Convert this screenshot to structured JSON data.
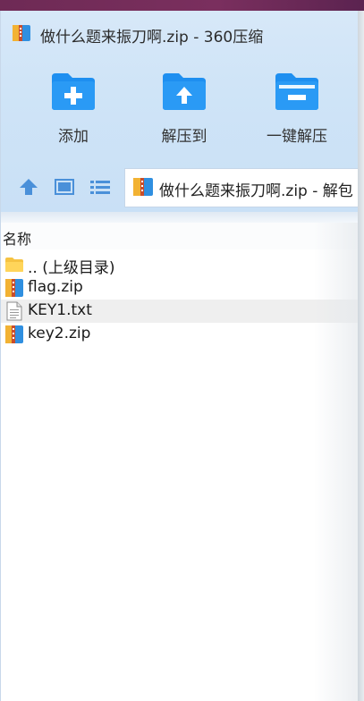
{
  "window": {
    "title": "做什么题来振刀啊.zip - 360压缩"
  },
  "toolbar": {
    "buttons": [
      {
        "label": "添加",
        "icon": "add-folder-icon"
      },
      {
        "label": "解压到",
        "icon": "extract-to-folder-icon"
      },
      {
        "label": "一键解压",
        "icon": "one-click-extract-icon"
      }
    ]
  },
  "navbar": {
    "icons": [
      "up-arrow-icon",
      "thumbnail-view-icon",
      "list-view-icon"
    ],
    "path": "做什么题来振刀啊.zip - 解包"
  },
  "columns": {
    "name": "名称"
  },
  "files": [
    {
      "name": ".. (上级目录)",
      "icon": "parent-folder-icon"
    },
    {
      "name": "flag.zip",
      "icon": "zip-archive-icon"
    },
    {
      "name": "KEY1.txt",
      "icon": "text-file-icon"
    },
    {
      "name": "key2.zip",
      "icon": "zip-archive-icon"
    }
  ],
  "colors": {
    "accent_blue": "#1e8ff0",
    "chrome_bg": "#cfe4f7",
    "selected_row": "#efefef"
  }
}
